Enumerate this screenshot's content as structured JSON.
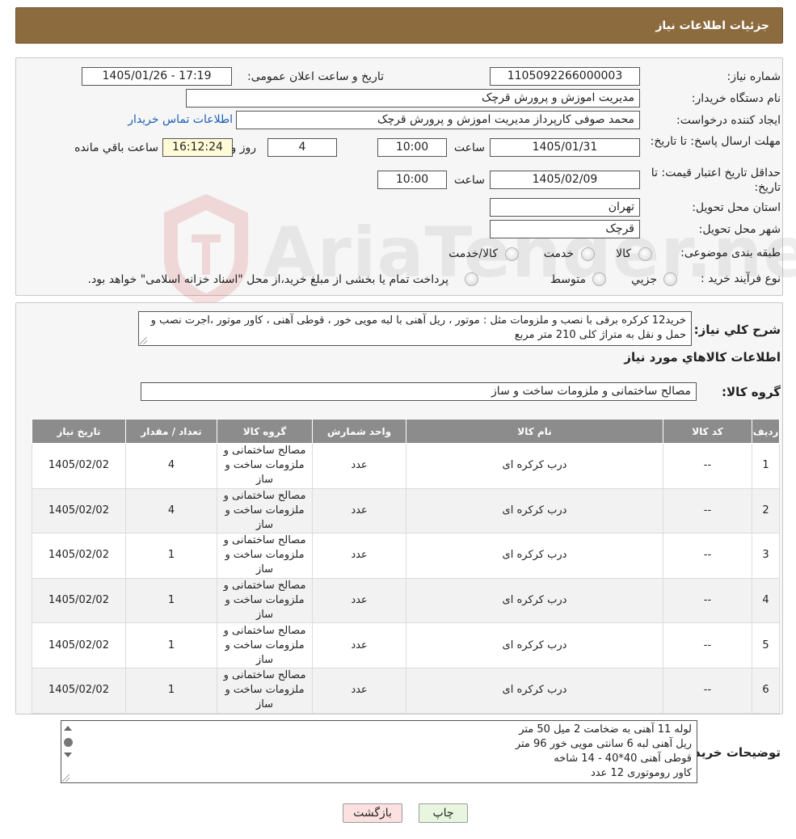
{
  "header": {
    "title": "جزئیات اطلاعات نیاز"
  },
  "form": {
    "need_number_label": "شماره نیاز:",
    "need_number": "1105092266000003",
    "announce_label": "تاریخ و ساعت اعلان عمومی:",
    "announce_value": "1405/01/26 - 17:19",
    "buyer_org_label": "نام دستگاه خریدار:",
    "buyer_org": "مدیریت اموزش و پرورش قرچک",
    "requester_label": "ایجاد کننده درخواست:",
    "requester": "محمد صوفی کارپرداز مدیریت اموزش و پرورش قرچک",
    "contact_link": "اطلاعات تماس خریدار",
    "reply_deadline_label": "مهلت ارسال پاسخ: تا تاریخ:",
    "reply_date": "1405/01/31",
    "time_label": "ساعت",
    "reply_time": "10:00",
    "days_value": "4",
    "days_label": "روز و",
    "remaining_time": "16:12:24",
    "remaining_label": "ساعت باقي مانده",
    "validity_label": "حداقل تاریخ اعتبار قیمت: تا تاریخ:",
    "validity_date": "1405/02/09",
    "validity_time": "10:00",
    "province_label": "استان محل تحویل:",
    "province": "تهران",
    "city_label": "شهر محل تحویل:",
    "city": "قرچک",
    "category_label": "طبقه بندی موضوعی:",
    "category_options": [
      "کالا",
      "خدمت",
      "کالا/خدمت"
    ],
    "process_label": "نوع فرآیند خرید :",
    "process_options": [
      "جزیي",
      "متوسط"
    ],
    "process_note": "پرداخت تمام یا بخشی از مبلغ خرید،از محل \"اسناد خزانه اسلامی\" خواهد بود."
  },
  "summary": {
    "label": "شرح کلي نیاز:",
    "text": "خرید12 کرکره برقی با نصب   و ملزومات مثل : موتور ، ریل آهنی با لبه مویی خور  ،  قوطی آهنی ، کاور موتور ،اجرت نصب و حمل و نقل به متراژ کلی 210 متر مربع"
  },
  "goods": {
    "section_title": "اطلاعات کالاهاي مورد نیاز",
    "group_label": "گروه کالا:",
    "group_value": "مصالح ساختمانی و ملزومات ساخت و ساز",
    "columns": [
      "ردیف",
      "کد کالا",
      "نام کالا",
      "واحد شمارش",
      "گروه کالا",
      "تعداد / مقدار",
      "تاریخ نیاز"
    ],
    "rows": [
      {
        "idx": "1",
        "code": "--",
        "name": "درب کرکره ای",
        "unit": "عدد",
        "group": "مصالح ساختمانی و ملزومات ساخت و ساز",
        "qty": "4",
        "date": "1405/02/02"
      },
      {
        "idx": "2",
        "code": "--",
        "name": "درب کرکره ای",
        "unit": "عدد",
        "group": "مصالح ساختمانی و ملزومات ساخت و ساز",
        "qty": "4",
        "date": "1405/02/02"
      },
      {
        "idx": "3",
        "code": "--",
        "name": "درب کرکره ای",
        "unit": "عدد",
        "group": "مصالح ساختمانی و ملزومات ساخت و ساز",
        "qty": "1",
        "date": "1405/02/02"
      },
      {
        "idx": "4",
        "code": "--",
        "name": "درب کرکره ای",
        "unit": "عدد",
        "group": "مصالح ساختمانی و ملزومات ساخت و ساز",
        "qty": "1",
        "date": "1405/02/02"
      },
      {
        "idx": "5",
        "code": "--",
        "name": "درب کرکره ای",
        "unit": "عدد",
        "group": "مصالح ساختمانی و ملزومات ساخت و ساز",
        "qty": "1",
        "date": "1405/02/02"
      },
      {
        "idx": "6",
        "code": "--",
        "name": "درب کرکره ای",
        "unit": "عدد",
        "group": "مصالح ساختمانی و ملزومات ساخت و ساز",
        "qty": "1",
        "date": "1405/02/02"
      }
    ]
  },
  "buyer_notes": {
    "label": "توضیحات خریدار:",
    "lines": [
      "لوله 11 آهنی به ضخامت 2 میل 50 متر",
      "ریل آهنی لبه 6 سانتی مویی خور 96 متر",
      "قوطی آهنی 40*40 - 14 شاخه",
      "کاور روموتوری 12 عدد"
    ]
  },
  "actions": {
    "print_label": "چاپ",
    "back_label": "بازگشت"
  },
  "watermark": {
    "text": "AriaTender.neT"
  },
  "colors": {
    "header_bg": "#8c6b3f",
    "table_header": "#8c8c8c",
    "remaining_bg": "#fffbd8",
    "back_button": "#fde0e0",
    "print_button": "#e8f6e0"
  }
}
